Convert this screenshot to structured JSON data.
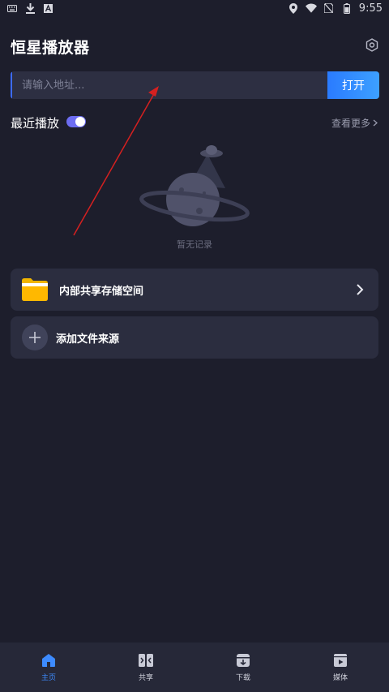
{
  "status_bar": {
    "time": "9:55",
    "left_icons": [
      "keyboard-icon",
      "download-icon",
      "font-icon"
    ],
    "right_icons": [
      "location-icon",
      "wifi-icon",
      "no-sim-icon",
      "battery-icon"
    ]
  },
  "header": {
    "title": "恒星播放器",
    "settings_icon": "hexagon-settings-icon"
  },
  "url_bar": {
    "placeholder": "请输入地址...",
    "value": "",
    "open_label": "打开"
  },
  "recent": {
    "label": "最近播放",
    "toggle_on": true,
    "see_more_label": "查看更多",
    "empty_text": "暂无记录"
  },
  "sources": [
    {
      "label": "内部共享存储空间",
      "icon": "folder-icon"
    },
    {
      "label": "添加文件来源",
      "icon": "plus-icon"
    }
  ],
  "bottom_nav": [
    {
      "label": "主页",
      "icon": "home-icon",
      "active": true
    },
    {
      "label": "共享",
      "icon": "share-icon",
      "active": false
    },
    {
      "label": "下载",
      "icon": "download-box-icon",
      "active": false
    },
    {
      "label": "媒体",
      "icon": "media-icon",
      "active": false
    }
  ],
  "colors": {
    "background": "#1d1e2c",
    "accent": "#3d8bff",
    "toggle": "#6d6df2",
    "annotation_arrow": "#d62020"
  }
}
